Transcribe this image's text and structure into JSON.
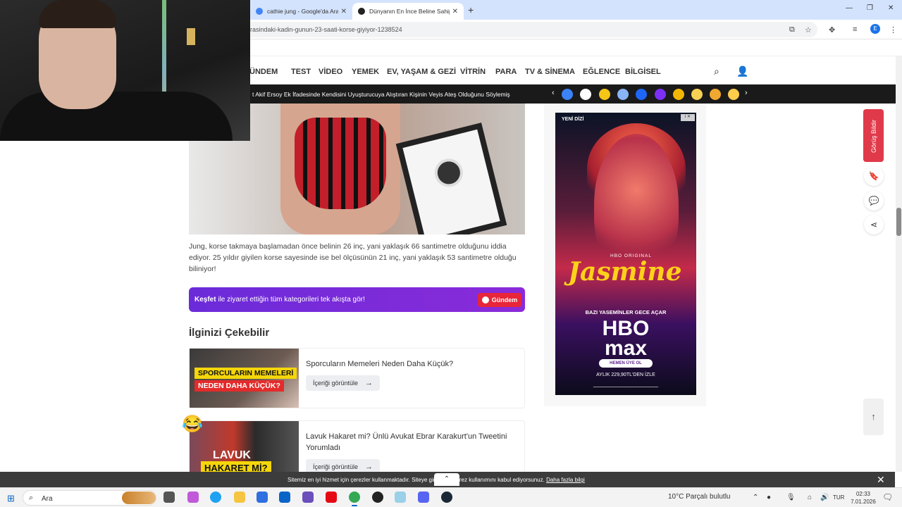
{
  "browser": {
    "tabs": [
      {
        "title": "cathie jung - Google'da Ara",
        "active": false
      },
      {
        "title": "Dünyanın En İnce Beline Sahip",
        "active": true
      }
    ],
    "new_tab": "+",
    "url": "rasindaki-kadin-gunun-23-saati-korse-giyiyor-1238524",
    "profile_initial": "E"
  },
  "site": {
    "nav": [
      "ÜNDEM",
      "TEST",
      "VİDEO",
      "YEMEK",
      "EV, YAŞAM & GEZİ",
      "VİTRİN",
      "PARA",
      "TV & SİNEMA",
      "EĞLENCE",
      "BİLGİSEL"
    ],
    "ticker": "t Akif Ersoy Ek İfadesinde Kendisini Uyuşturucuya Alıştıran Kişinin Veyis Ateş Olduğunu Söylemiş"
  },
  "article": {
    "paragraph": "Jung, korse takmaya başlamadan önce belinin 26 inç, yani yaklaşık 66 santimetre olduğunu iddia ediyor. 25 yıldır giyilen korse sayesinde ise bel ölçüsünün 21 inç, yani yaklaşık 53 santimetre olduğu biliniyor!",
    "discover": {
      "bold": "Keşfet",
      "text": " ile ziyaret ettiğin tüm kategorileri tek akışta gör!",
      "button": "Gündem"
    },
    "related_title": "İlginizi Çekebilir",
    "cards": [
      {
        "title": "Sporcuların Memeleri Neden Daha Küçük?",
        "cta": "İçeriği görüntüle",
        "thumb_line1": "SPORCULARIN MEMELERİ",
        "thumb_line2": "NEDEN DAHA KÜÇÜK?"
      },
      {
        "title": "Lavuk Hakaret mi? Ünlü Avukat Ebrar Karakurt'un Tweetini Yorumladı",
        "cta": "İçeriği görüntüle",
        "thumb_line1": "LAVUK",
        "thumb_line2": "HAKARET Mİ?"
      }
    ],
    "emoji": "😂"
  },
  "ad": {
    "tag": "YENİ DİZİ",
    "hbo_original": "HBO ORIGINAL",
    "brand": "Jasmine",
    "tagline": "BAZI YASEMİNLER GECE AÇAR",
    "logo_line1": "HBO",
    "logo_line2": "max",
    "member": "HEMEN ÜYE OL",
    "price": "AYLIK 229,90TL'DEN İZLE"
  },
  "side": {
    "feedback": "Görüş Bildir"
  },
  "cookie": {
    "text_a": "Sitemiz en iyi hizmet için çerezler kullanmaktadır. Siteye gir",
    "text_b": "erez kullanımını kabul ediyorsunuz.",
    "link": "Daha fazla bilgi"
  },
  "taskbar": {
    "search_placeholder": "Ara",
    "weather": "10°C  Parçalı bulutlu",
    "lang": "TUR",
    "time": "02:33",
    "date": "7.01.2026"
  }
}
